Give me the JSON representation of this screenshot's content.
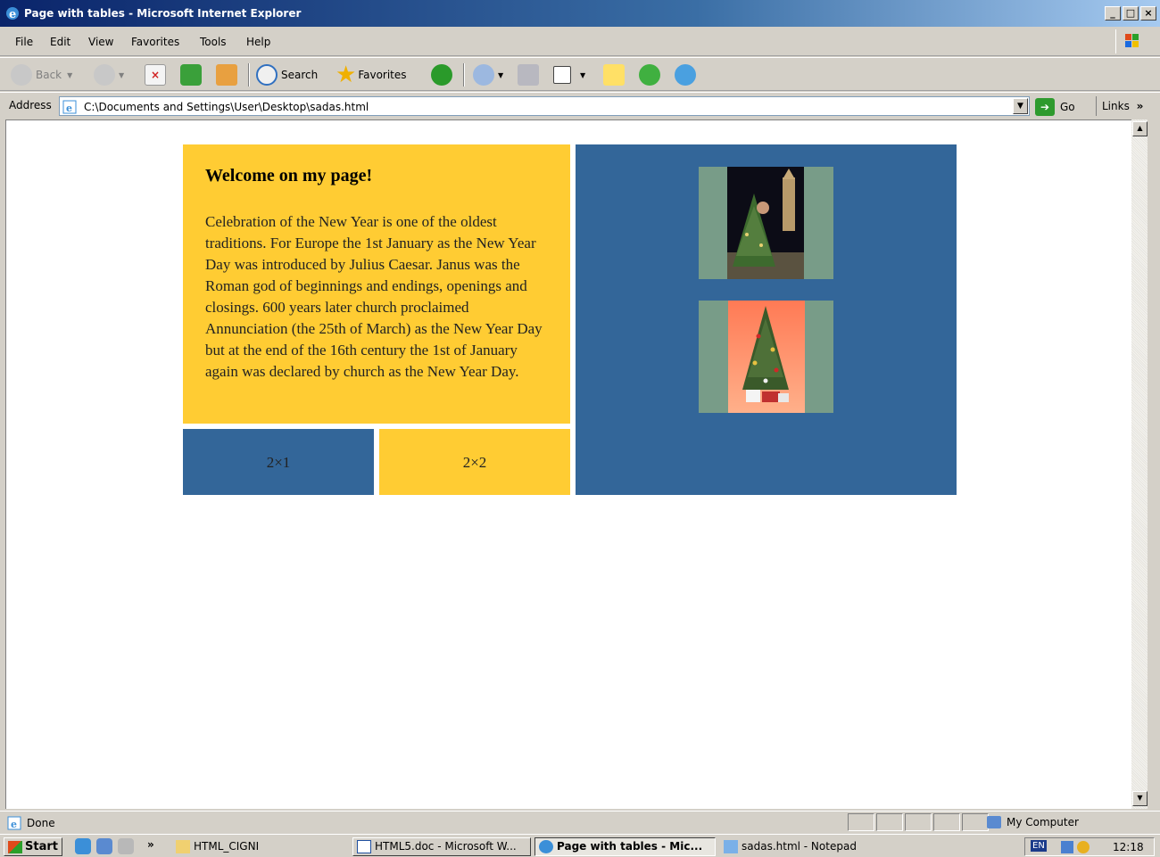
{
  "window": {
    "title": "Page with tables - Microsoft Internet Explorer",
    "controls": [
      "_",
      "̲□",
      "×"
    ]
  },
  "menu": {
    "items": [
      "File",
      "Edit",
      "View",
      "Favorites",
      "Tools",
      "Help"
    ]
  },
  "toolbar": {
    "back_label": "Back",
    "search_label": "Search",
    "favorites_label": "Favorites"
  },
  "address": {
    "label": "Address",
    "url": "C:\\Documents and Settings\\User\\Desktop\\sadas.html",
    "go_label": "Go",
    "links_label": "Links"
  },
  "page": {
    "heading": "Welcome on my page!",
    "body": "Celebration of the New Year is one of the oldest traditions. For Europe the 1st January as the New Year Day was introduced by Julius Caesar. Janus was the Roman god of beginnings and endings, openings and closings. 600 years later church proclaimed Annunciation (the 25th of March) as the New Year Day but at the end of the 16th century the 1st of January again was declared by church as the New Year Day.",
    "cell_2x1": "2×1",
    "cell_2x2": "2×2",
    "colors": {
      "yellow": "#ffcc33",
      "blue": "#336699",
      "frame": "#789c88"
    }
  },
  "status": {
    "text": "Done",
    "zone": "My Computer"
  },
  "taskbar": {
    "start_label": "start",
    "overflow": "»",
    "items": [
      {
        "label": "HTML_CIGNI",
        "icon": "folder-icon"
      },
      {
        "label": "HTML5.doc - Microsoft W...",
        "icon": "word-icon"
      },
      {
        "label": "Page with tables - Mic...",
        "icon": "ie-icon"
      },
      {
        "label": "sadas.html - Notepad",
        "icon": "notepad-icon"
      }
    ],
    "lang": "EN",
    "time": "12:18"
  }
}
